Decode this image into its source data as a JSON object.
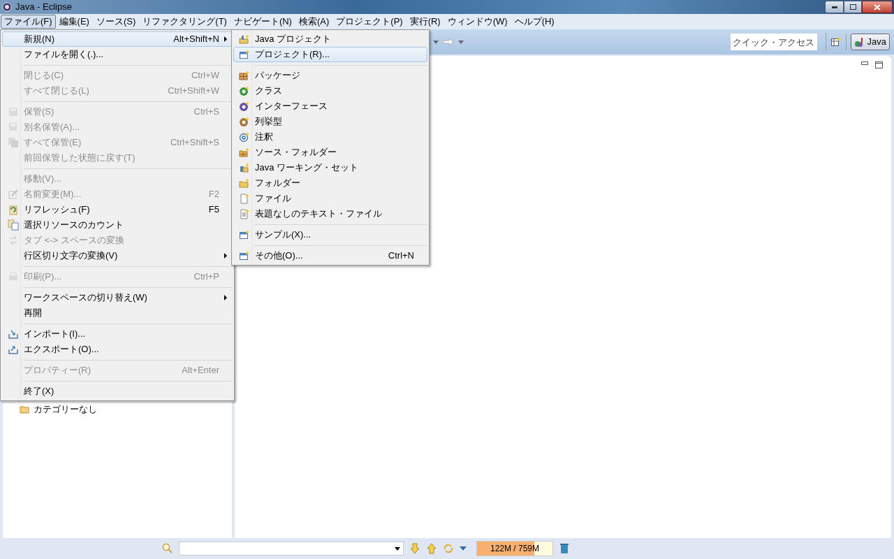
{
  "window": {
    "title": "Java - Eclipse"
  },
  "menubar": [
    {
      "label": "ファイル(F)",
      "selected": true
    },
    {
      "label": "編集(E)",
      "selected": false
    },
    {
      "label": "ソース(S)",
      "selected": false
    },
    {
      "label": "リファクタリング(T)",
      "selected": false
    },
    {
      "label": "ナビゲート(N)",
      "selected": false
    },
    {
      "label": "検索(A)",
      "selected": false
    },
    {
      "label": "プロジェクト(P)",
      "selected": false
    },
    {
      "label": "実行(R)",
      "selected": false
    },
    {
      "label": "ウィンドウ(W)",
      "selected": false
    },
    {
      "label": "ヘルプ(H)",
      "selected": false
    }
  ],
  "toolbar": {
    "quick_access": {
      "placeholder": "クイック・アクセス"
    },
    "perspective": {
      "label": "Java",
      "selected": true
    }
  },
  "file_menu": [
    {
      "kind": "item",
      "label": "新規(N)",
      "shortcut": "Alt+Shift+N",
      "submenu": true,
      "disabled": false,
      "selected": true
    },
    {
      "kind": "item",
      "label": "ファイルを開く(.)...",
      "submenu": false,
      "disabled": false,
      "selected": false
    },
    {
      "kind": "separator"
    },
    {
      "kind": "item",
      "label": "閉じる(C)",
      "shortcut": "Ctrl+W",
      "submenu": false,
      "disabled": true,
      "selected": false
    },
    {
      "kind": "item",
      "label": "すべて閉じる(L)",
      "shortcut": "Ctrl+Shift+W",
      "submenu": false,
      "disabled": true,
      "selected": false
    },
    {
      "kind": "separator"
    },
    {
      "kind": "item",
      "label": "保管(S)",
      "shortcut": "Ctrl+S",
      "submenu": false,
      "disabled": true,
      "selected": false
    },
    {
      "kind": "item",
      "label": "別名保管(A)...",
      "submenu": false,
      "disabled": true,
      "selected": false
    },
    {
      "kind": "item",
      "label": "すべて保管(E)",
      "shortcut": "Ctrl+Shift+S",
      "submenu": false,
      "disabled": true,
      "selected": false
    },
    {
      "kind": "item",
      "label": "前回保管した状態に戻す(T)",
      "submenu": false,
      "disabled": true,
      "selected": false
    },
    {
      "kind": "separator"
    },
    {
      "kind": "item",
      "label": "移動(V)...",
      "submenu": false,
      "disabled": true,
      "selected": false
    },
    {
      "kind": "item",
      "label": "名前変更(M)...",
      "shortcut": "F2",
      "submenu": false,
      "disabled": true,
      "selected": false
    },
    {
      "kind": "item",
      "label": "リフレッシュ(F)",
      "shortcut": "F5",
      "submenu": false,
      "disabled": false,
      "selected": false
    },
    {
      "kind": "item",
      "label": "選択リソースのカウント",
      "submenu": false,
      "disabled": false,
      "selected": false
    },
    {
      "kind": "item",
      "label": "タブ <-> スペースの変換",
      "submenu": false,
      "disabled": true,
      "selected": false
    },
    {
      "kind": "item",
      "label": "行区切り文字の変換(V)",
      "submenu": true,
      "disabled": false,
      "selected": false
    },
    {
      "kind": "separator"
    },
    {
      "kind": "item",
      "label": "印刷(P)...",
      "shortcut": "Ctrl+P",
      "submenu": false,
      "disabled": true,
      "selected": false
    },
    {
      "kind": "separator"
    },
    {
      "kind": "item",
      "label": "ワークスペースの切り替え(W)",
      "submenu": true,
      "disabled": false,
      "selected": false
    },
    {
      "kind": "item",
      "label": "再開",
      "submenu": false,
      "disabled": false,
      "selected": false
    },
    {
      "kind": "separator"
    },
    {
      "kind": "item",
      "label": "インポート(I)...",
      "submenu": false,
      "disabled": false,
      "selected": false
    },
    {
      "kind": "item",
      "label": "エクスポート(O)...",
      "submenu": false,
      "disabled": false,
      "selected": false
    },
    {
      "kind": "separator"
    },
    {
      "kind": "item",
      "label": "プロパティー(R)",
      "shortcut": "Alt+Enter",
      "submenu": false,
      "disabled": true,
      "selected": false
    },
    {
      "kind": "separator"
    },
    {
      "kind": "item",
      "label": "終了(X)",
      "submenu": false,
      "disabled": false,
      "selected": false
    }
  ],
  "new_submenu": [
    {
      "kind": "item",
      "label": "Java プロジェクト",
      "selected": false
    },
    {
      "kind": "item",
      "label": "プロジェクト(R)...",
      "selected": true
    },
    {
      "kind": "separator"
    },
    {
      "kind": "item",
      "label": "パッケージ",
      "selected": false
    },
    {
      "kind": "item",
      "label": "クラス",
      "selected": false
    },
    {
      "kind": "item",
      "label": "インターフェース",
      "selected": false
    },
    {
      "kind": "item",
      "label": "列挙型",
      "selected": false
    },
    {
      "kind": "item",
      "label": "注釈",
      "selected": false
    },
    {
      "kind": "item",
      "label": "ソース・フォルダー",
      "selected": false
    },
    {
      "kind": "item",
      "label": "Java ワーキング・セット",
      "selected": false
    },
    {
      "kind": "item",
      "label": "フォルダー",
      "selected": false
    },
    {
      "kind": "item",
      "label": "ファイル",
      "selected": false
    },
    {
      "kind": "item",
      "label": "表題なしのテキスト・ファイル",
      "selected": false
    },
    {
      "kind": "separator"
    },
    {
      "kind": "item",
      "label": "サンプル(X)...",
      "selected": false
    },
    {
      "kind": "separator"
    },
    {
      "kind": "item",
      "label": "その他(O)...",
      "shortcut": "Ctrl+N",
      "selected": false
    }
  ],
  "explorer": {
    "items": [
      {
        "label": "カテゴリーなし"
      }
    ]
  },
  "status_bar": {
    "heap": {
      "reading": "122M / 759M",
      "level": 0.76
    }
  }
}
